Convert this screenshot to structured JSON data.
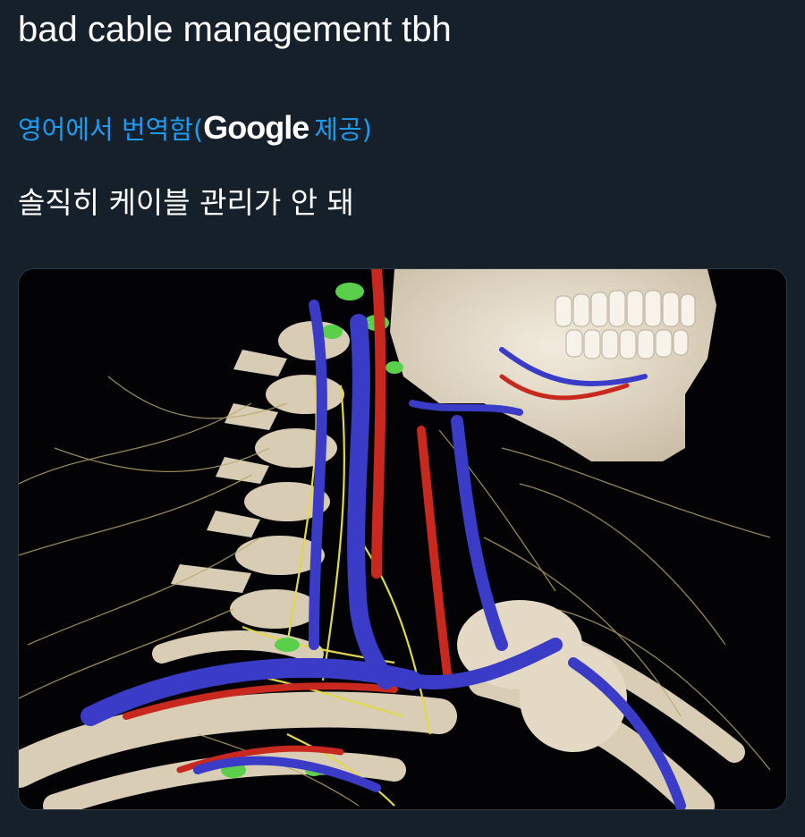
{
  "tweet": {
    "text": "bad cable management tbh"
  },
  "translation": {
    "prefix": "영어에서 번역함(",
    "provider": "Google",
    "suffix": " 제공)",
    "translated_text": "솔직히 케이블 관리가 안 돼"
  },
  "media": {
    "icon": "anatomy-neck-image",
    "colors": {
      "background": "#030306",
      "bone": "#e8dcc8",
      "vein": "#3a3cc8",
      "artery": "#c8281e",
      "nerve": "#e0d84a",
      "lymph": "#5ad04a"
    }
  }
}
